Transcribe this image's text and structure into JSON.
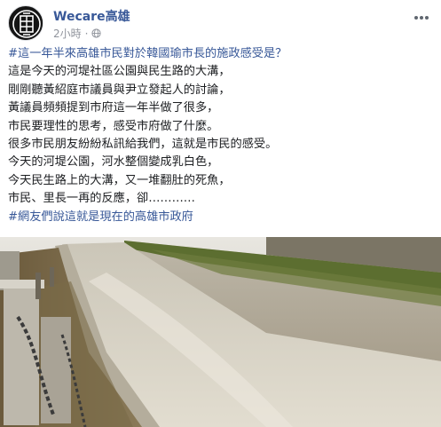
{
  "post": {
    "page_name": "Wecare高雄",
    "timestamp": "2小時",
    "meta_separator": "·",
    "privacy_icon": "globe-icon",
    "more_icon": "more-options-icon",
    "body_lines": [
      "#這一年半來高雄市民對於韓國瑜市長的施政感受是？",
      "這是今天的河堤社區公園與民生路的大溝，",
      "剛剛聽黃紹庭市議員與尹立發起人的討論，",
      "黃議員頻頻提到市府這一年半做了很多，",
      "市民要理性的思考，感受市府做了什麼。",
      "很多市民朋友紛紛私訊給我們，這就是市民的感受。",
      "今天的河堤公園，河水整個變成乳白色，",
      "今天民生路上的大溝，又一堆翻肚的死魚，",
      "市民、里長一再的反應，卻…………",
      "#網友們說這就是現在的高雄市政府"
    ]
  },
  "colors": {
    "link": "#385898",
    "text": "#1c1e21",
    "meta": "#90949c",
    "river": "#d9d3c3",
    "wall": "#b8b2a4",
    "moss": "#5c6e30"
  }
}
